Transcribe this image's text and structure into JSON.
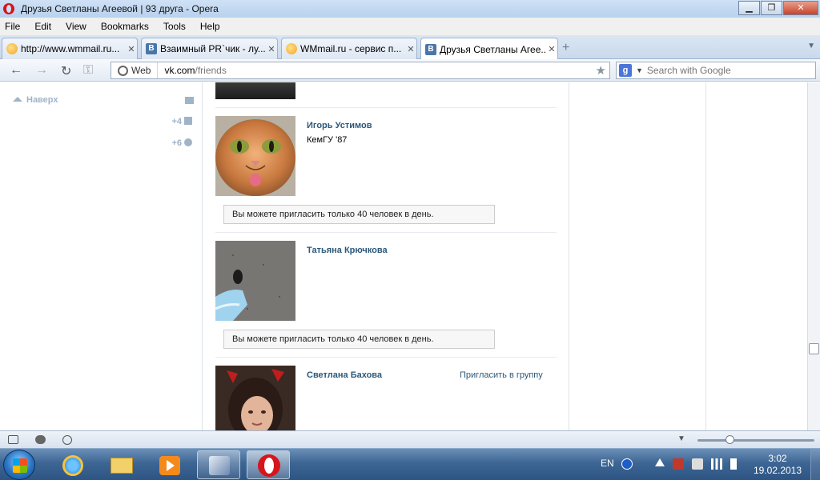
{
  "window": {
    "title": "Друзья Светланы Агеевой | 93 друга - Opera",
    "minimize": "▁",
    "maximize": "❐",
    "close": "✕"
  },
  "menu": [
    "File",
    "Edit",
    "View",
    "Bookmarks",
    "Tools",
    "Help"
  ],
  "tabs": [
    {
      "label": "http://www.wmmail.ru...",
      "favicon": "wmmail-icon",
      "active": false
    },
    {
      "label": "Взаимный PR`чик - лу...",
      "favicon": "vk-icon",
      "active": false
    },
    {
      "label": "WMmail.ru - сервис п...",
      "favicon": "wmmail-icon",
      "active": false
    },
    {
      "label": "Друзья Светланы Агее...",
      "favicon": "vk-icon",
      "active": true
    }
  ],
  "tab_close": "✕",
  "tab_favicon_vk": "B",
  "new_tab": "+",
  "address": {
    "web_label": "Web",
    "url_host": "vk.com",
    "url_path": "/friends"
  },
  "search": {
    "engine_letter": "g",
    "placeholder": "Search with Google"
  },
  "sidebar": {
    "up_label": "Наверх",
    "counters": [
      {
        "value": "+4",
        "icon": "people-icon"
      },
      {
        "value": "+6",
        "icon": "gear-icon"
      }
    ]
  },
  "friends": [
    {
      "name": "Игорь Устимов",
      "subtitle": "КемГУ '87",
      "notice": "Вы можете пригласить только 40 человек в день.",
      "photo": "cat-photo"
    },
    {
      "name": "Татьяна Крючкова",
      "subtitle": "",
      "notice": "Вы можете пригласить только 40 человек в день.",
      "photo": "road-photo"
    },
    {
      "name": "Светлана Бахова",
      "subtitle": "",
      "action": "Пригласить в группу",
      "photo": "portrait-photo"
    }
  ],
  "taskbar": {
    "lang": "EN",
    "time": "3:02",
    "date": "19.02.2013"
  },
  "colors": {
    "link": "#2b587a",
    "sidebar_muted": "#a1b3c7",
    "opera_red": "#d8141b"
  }
}
